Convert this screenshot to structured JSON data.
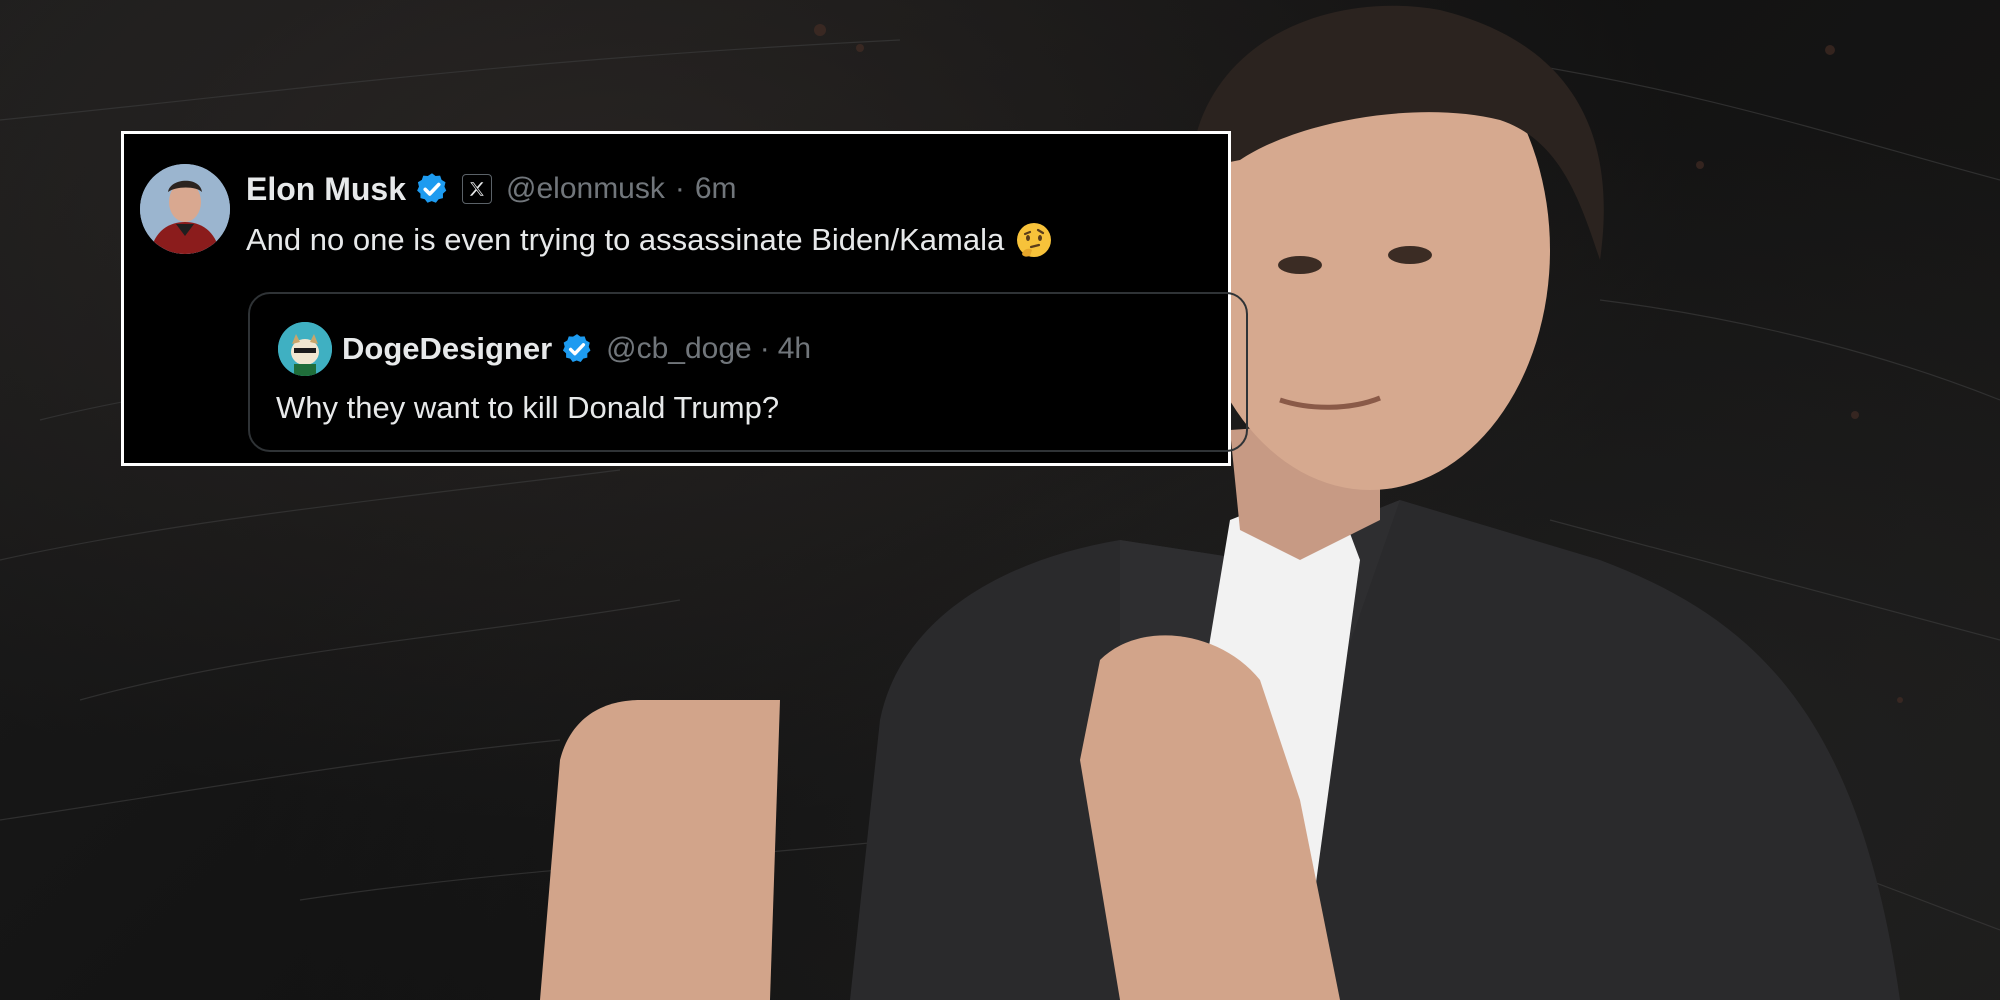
{
  "tweet": {
    "author_name": "Elon Musk",
    "author_handle": "@elonmusk",
    "time_separator": "·",
    "time": "6m",
    "text": "And no one is even trying to assassinate Biden/Kamala",
    "affiliate_badge_icon": "x-logo-icon",
    "verified_icon": "verified-badge-icon",
    "emoji_icon": "thinking-face-emoji"
  },
  "quoted_tweet": {
    "author_name": "DogeDesigner",
    "author_handle": "@cb_doge",
    "time_separator": "·",
    "time": "4h",
    "text": "Why they want to kill Donald Trump?",
    "verified_icon": "verified-badge-icon"
  },
  "colors": {
    "card_background": "#000000",
    "card_border": "#ffffff",
    "primary_text": "#e7e9ea",
    "secondary_text": "#71767b",
    "verified_blue": "#1d9bf0",
    "quote_border": "#2f3336"
  }
}
